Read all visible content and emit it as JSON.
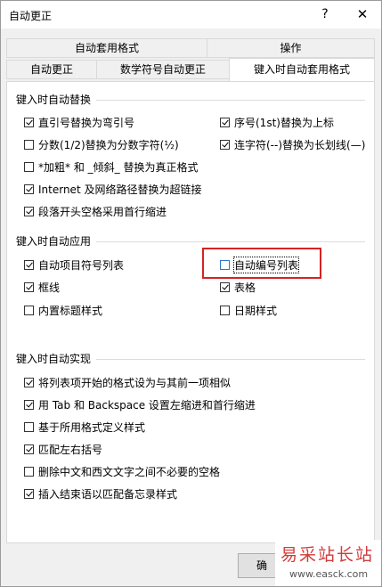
{
  "window": {
    "title": "自动更正",
    "help_icon": "?",
    "close_icon": "✕"
  },
  "tabs": {
    "row1": [
      {
        "label": "自动套用格式"
      },
      {
        "label": "操作"
      }
    ],
    "row2": [
      {
        "label": "自动更正"
      },
      {
        "label": "数学符号自动更正"
      },
      {
        "label": "键入时自动套用格式",
        "active": true
      }
    ]
  },
  "section1": {
    "heading": "键入时自动替换",
    "options": [
      {
        "label": "直引号替换为弯引号",
        "checked": true
      },
      {
        "label": "序号(1st)替换为上标",
        "checked": true
      },
      {
        "label": "分数(1/2)替换为分数字符(½)",
        "checked": false
      },
      {
        "label": "连字符(--)替换为长划线(—)",
        "checked": true
      },
      {
        "label": "*加粗* 和 _倾斜_ 替换为真正格式",
        "checked": false
      },
      {
        "label": "Internet 及网络路径替换为超链接",
        "checked": true
      },
      {
        "label": "段落开头空格采用首行缩进",
        "checked": true
      }
    ]
  },
  "section2": {
    "heading": "键入时自动应用",
    "options": [
      {
        "label": "自动项目符号列表",
        "checked": true
      },
      {
        "label": "自动编号列表",
        "checked": false
      },
      {
        "label": "框线",
        "checked": true
      },
      {
        "label": "表格",
        "checked": true
      },
      {
        "label": "内置标题样式",
        "checked": false
      },
      {
        "label": "日期样式",
        "checked": false
      }
    ]
  },
  "section3": {
    "heading": "键入时自动实现",
    "options": [
      {
        "label": "将列表项开始的格式设为与其前一项相似",
        "checked": true
      },
      {
        "label": "用 Tab 和 Backspace 设置左缩进和首行缩进",
        "checked": true
      },
      {
        "label": "基于所用格式定义样式",
        "checked": false
      },
      {
        "label": "匹配左右括号",
        "checked": true
      },
      {
        "label": "删除中文和西文文字之间不必要的空格",
        "checked": false
      },
      {
        "label": "插入结束语以匹配备忘录样式",
        "checked": true
      }
    ]
  },
  "ok_button": {
    "label": "确"
  },
  "watermark": {
    "line1": "易采站长站",
    "line2": "www.easck.com"
  },
  "colors": {
    "highlight": "#d62222",
    "panel": "#ffffff",
    "window": "#f0f0f0"
  }
}
